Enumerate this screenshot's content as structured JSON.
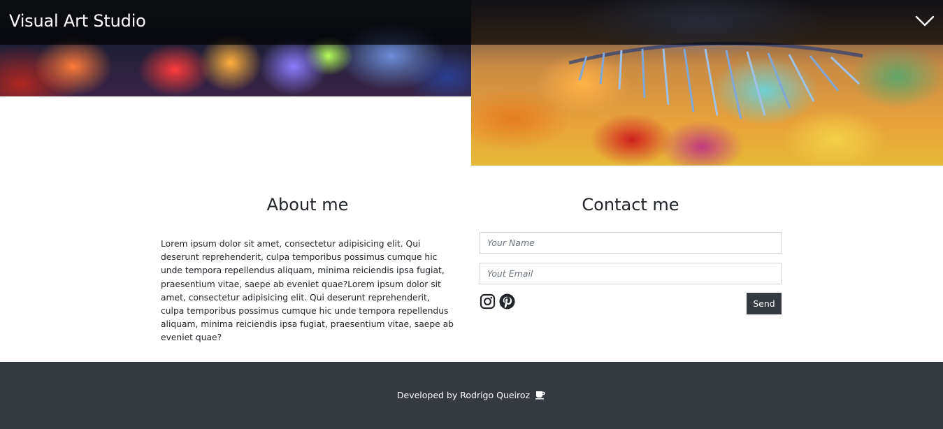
{
  "header": {
    "brand": "Visual Art Studio",
    "menu_icon": "chevron-down-icon"
  },
  "hero": {
    "images": [
      "abstract-painting-figure",
      "painting-eye-closeup"
    ]
  },
  "about": {
    "title": "About me",
    "text": "Lorem ipsum dolor sit amet, consectetur adipisicing elit. Qui deserunt reprehenderit, culpa temporibus possimus cumque hic unde tempora repellendus aliquam, minima reiciendis ipsa fugiat, praesentium vitae, saepe ab eveniet quae?Lorem ipsum dolor sit amet, consectetur adipisicing elit. Qui deserunt reprehenderit, culpa temporibus possimus cumque hic unde tempora repellendus aliquam, minima reiciendis ipsa fugiat, praesentium vitae, saepe ab eveniet quae?"
  },
  "contact": {
    "title": "Contact me",
    "name_placeholder": "Your Name",
    "name_value": "",
    "email_placeholder": "Yout Email",
    "email_value": "",
    "send_label": "Send",
    "social_icons": [
      "instagram-icon",
      "pinterest-icon"
    ]
  },
  "footer": {
    "credit": "Developed by Rodrigo Queiroz",
    "icon": "coffee-cup-icon"
  },
  "colors": {
    "dark": "#343a40",
    "topbar_overlay": "rgba(0,0,0,0.70)",
    "text": "#212529",
    "white": "#ffffff"
  }
}
